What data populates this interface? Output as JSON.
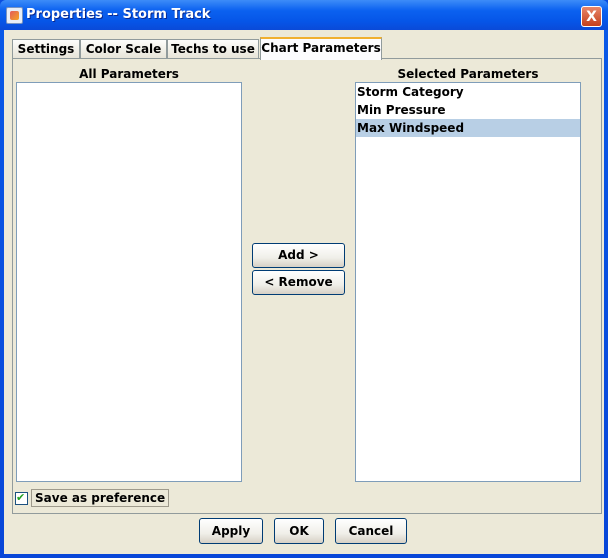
{
  "window": {
    "title": "Properties -- Storm Track",
    "close_glyph": "X"
  },
  "tabs": [
    {
      "label": "Settings"
    },
    {
      "label": "Color Scale"
    },
    {
      "label": "Techs to use"
    },
    {
      "label": "Chart Parameters"
    }
  ],
  "chart_parameters": {
    "all_label": "All Parameters",
    "all_items": [],
    "selected_label": "Selected Parameters",
    "selected_items": [
      "Storm Category",
      "Min Pressure",
      "Max Windspeed"
    ],
    "selected_highlight": "Max Windspeed",
    "add_label": "Add  >",
    "remove_label": "<  Remove",
    "save_pref_label": "Save as preference",
    "save_pref_checked": true
  },
  "footer": {
    "apply_label": "Apply",
    "ok_label": "OK",
    "cancel_label": "Cancel"
  },
  "colors": {
    "titlebar": "#0656e8",
    "selection": "#b8cfe5",
    "tab_accent": "#f0b030"
  }
}
